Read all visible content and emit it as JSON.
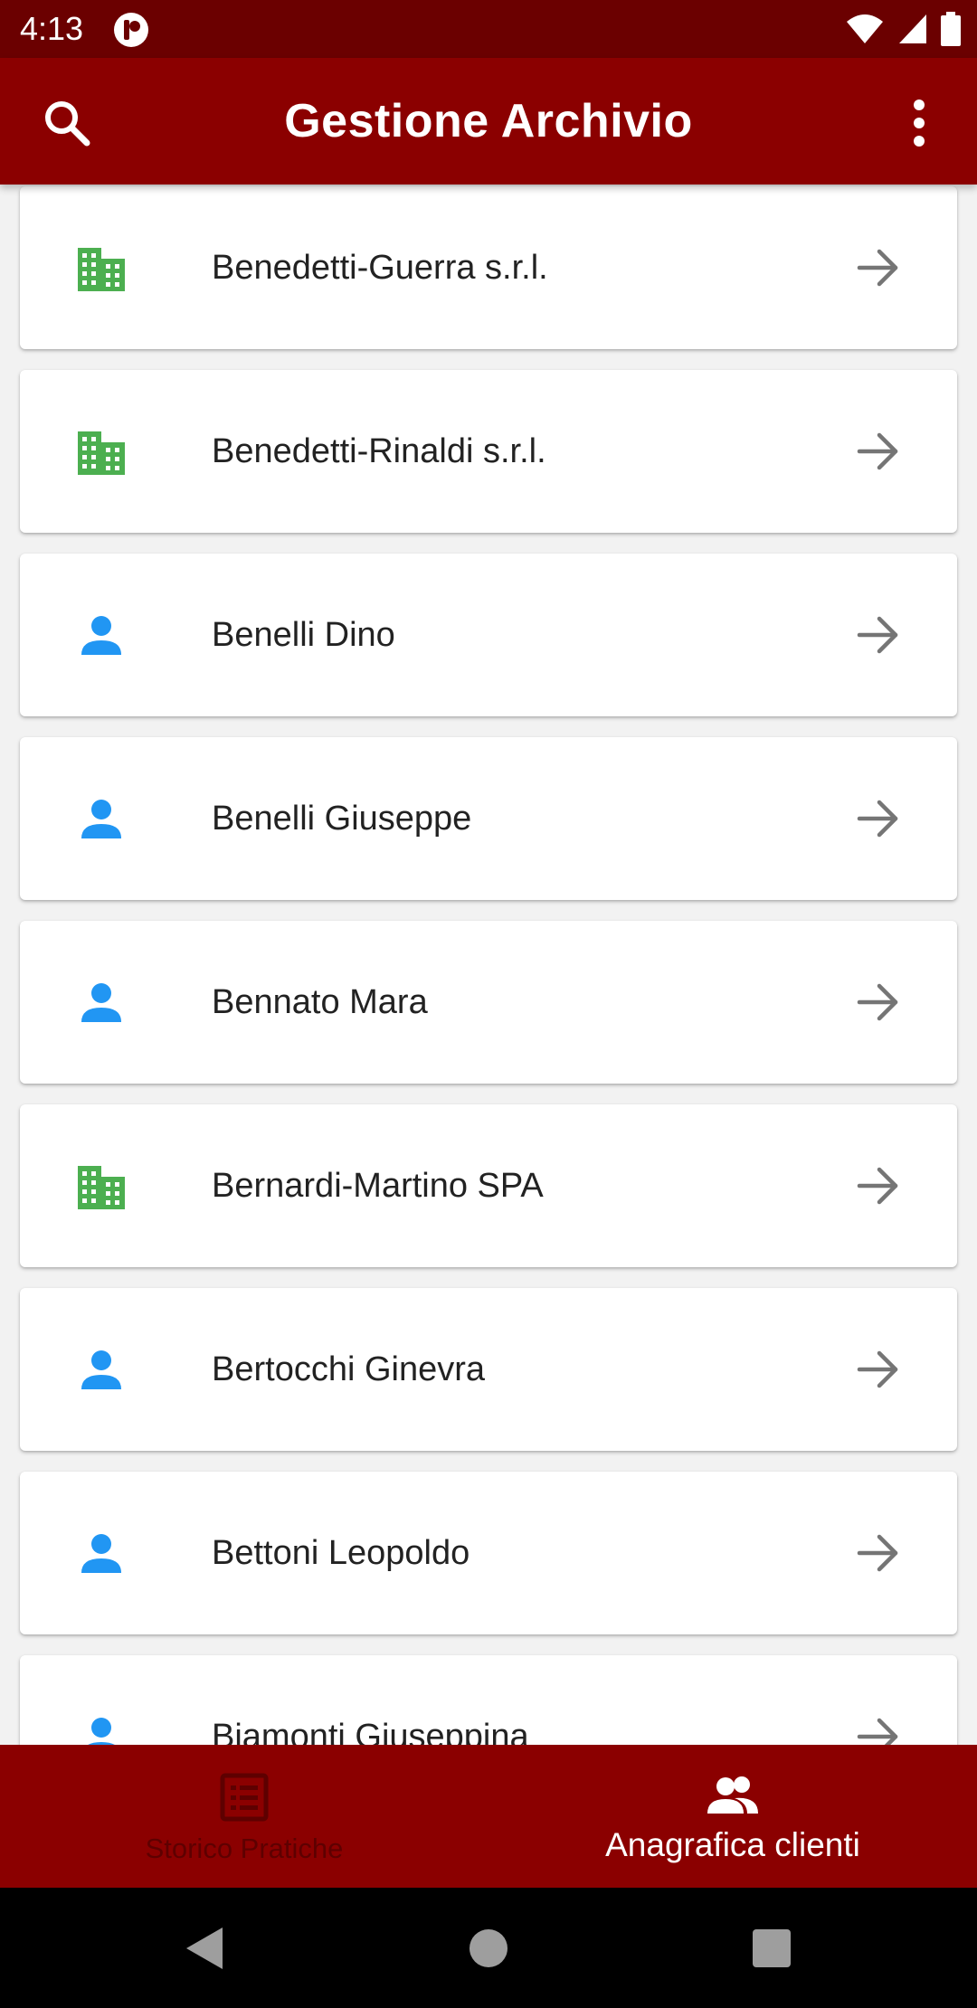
{
  "status_bar": {
    "time": "4:13",
    "icons": [
      "app-notification-icon",
      "wifi-icon",
      "signal-icon",
      "battery-icon"
    ]
  },
  "app_bar": {
    "title": "Gestione Archivio",
    "icons": [
      "search-icon",
      "more-vert-icon"
    ]
  },
  "colors": {
    "primary": "#8b0000",
    "status_bar": "#6b0000",
    "company_icon": "#4caf50",
    "person_icon": "#2196f3",
    "arrow": "#757575",
    "inactive_tab": "#5e0000"
  },
  "clients": [
    {
      "name": "Benedetti-Guerra s.r.l.",
      "type": "company",
      "icon": "building-icon"
    },
    {
      "name": "Benedetti-Rinaldi s.r.l.",
      "type": "company",
      "icon": "building-icon"
    },
    {
      "name": "Benelli Dino",
      "type": "person",
      "icon": "person-icon"
    },
    {
      "name": "Benelli Giuseppe",
      "type": "person",
      "icon": "person-icon"
    },
    {
      "name": "Bennato Mara",
      "type": "person",
      "icon": "person-icon"
    },
    {
      "name": "Bernardi-Martino SPA",
      "type": "company",
      "icon": "building-icon"
    },
    {
      "name": "Bertocchi Ginevra",
      "type": "person",
      "icon": "person-icon"
    },
    {
      "name": "Bettoni Leopoldo",
      "type": "person",
      "icon": "person-icon"
    },
    {
      "name": "Biamonti Giuseppina",
      "type": "person",
      "icon": "person-icon"
    }
  ],
  "bottom_nav": {
    "items": [
      {
        "label": "Storico Pratiche",
        "icon": "list-alt-icon",
        "active": false
      },
      {
        "label": "Anagrafica clienti",
        "icon": "people-icon",
        "active": true
      }
    ]
  },
  "system_nav": {
    "icons": [
      "back-icon",
      "home-icon",
      "recents-icon"
    ]
  }
}
